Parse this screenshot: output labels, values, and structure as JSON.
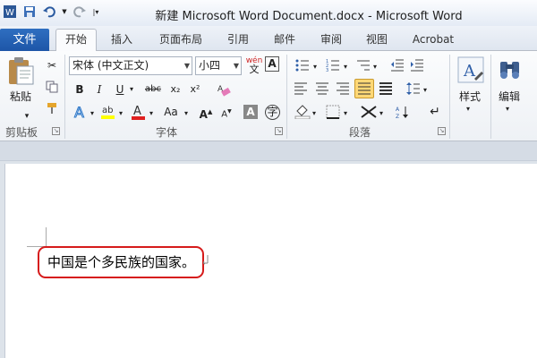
{
  "window": {
    "title": "新建 Microsoft Word Document.docx - Microsoft Word"
  },
  "qat": {
    "word_icon": "word-icon",
    "save_icon": "save-icon",
    "undo_icon": "undo-icon",
    "redo_icon": "redo-icon"
  },
  "tabs": [
    {
      "label": "文件"
    },
    {
      "label": "开始"
    },
    {
      "label": "插入"
    },
    {
      "label": "页面布局"
    },
    {
      "label": "引用"
    },
    {
      "label": "邮件"
    },
    {
      "label": "审阅"
    },
    {
      "label": "视图"
    },
    {
      "label": "Acrobat"
    }
  ],
  "ribbon": {
    "clipboard": {
      "group_label": "剪贴板",
      "paste_label": "粘贴"
    },
    "font": {
      "group_label": "字体",
      "font_name": "宋体 (中文正文)",
      "font_size": "小四",
      "bold": "B",
      "italic": "I",
      "underline": "U",
      "strike": "abc",
      "subscript": "x₂",
      "superscript": "x²",
      "grow": "A",
      "shrink": "A",
      "case": "Aa",
      "color_a": "A",
      "wen": "wén"
    },
    "paragraph": {
      "group_label": "段落"
    },
    "styles": {
      "label": "样式"
    },
    "editing": {
      "label": "编辑"
    }
  },
  "document": {
    "text": "中国是个多民族的国家。"
  },
  "colors": {
    "file_tab": "#2a66b8",
    "highlight_box": "#d61b1b",
    "font_color": "#e02020",
    "highlight_color": "#ffff00"
  }
}
